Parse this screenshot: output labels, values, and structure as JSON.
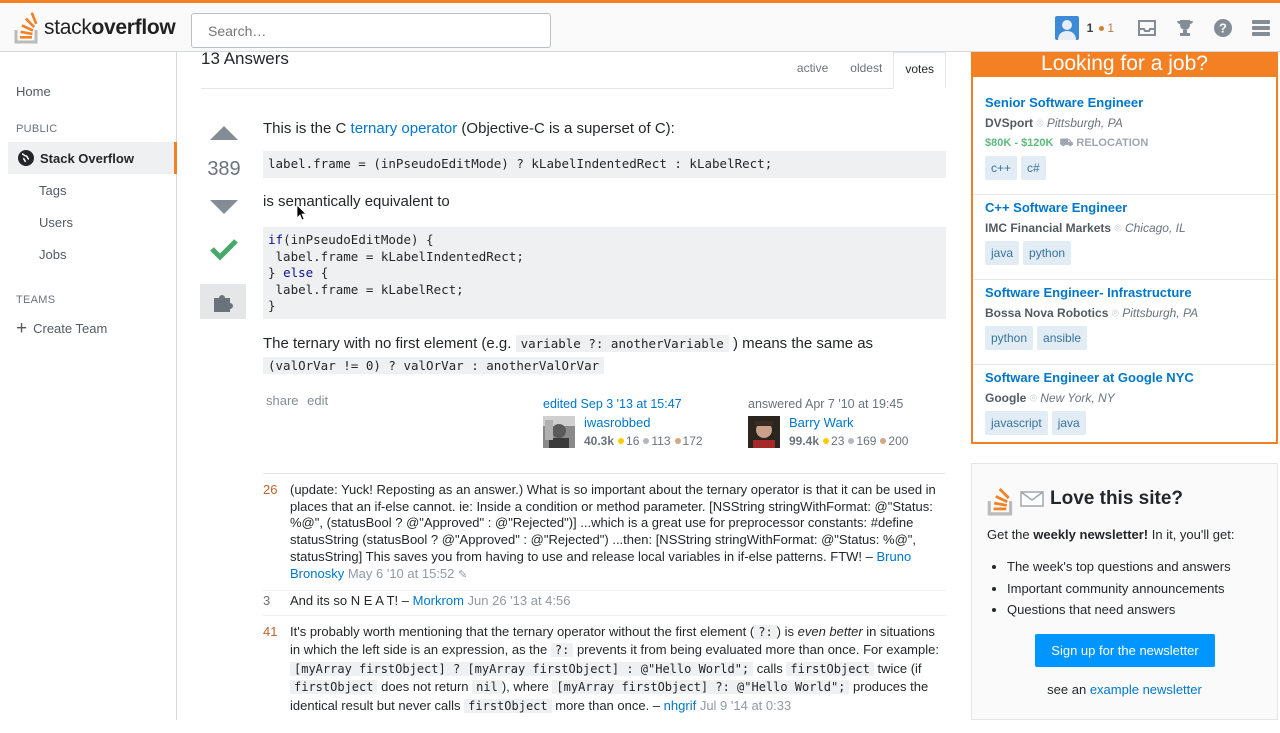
{
  "header": {
    "logo_text_light": "stack",
    "logo_text_bold": "overflow",
    "search_placeholder": "Search…",
    "reputation": "1",
    "bronze_badges": "1"
  },
  "nav": {
    "home": "Home",
    "public_label": "PUBLIC",
    "stack_overflow": "Stack Overflow",
    "tags": "Tags",
    "users": "Users",
    "jobs": "Jobs",
    "teams_label": "TEAMS",
    "create_team": "Create Team"
  },
  "answers": {
    "count_label": "13 Answers",
    "tabs": [
      "active",
      "oldest",
      "votes"
    ],
    "active_tab": "votes"
  },
  "answer": {
    "score": "389",
    "p1_pre": "This is the C ",
    "p1_link": "ternary operator",
    "p1_post": " (Objective-C is a superset of C):",
    "code1": "label.frame = (inPseudoEditMode) ? kLabelIndentedRect : kLabelRect;",
    "p2": "is semantically equivalent to",
    "code2_l1_a": "if",
    "code2_l1_b": "(inPseudoEditMode) {",
    "code2_l2": " label.frame = kLabelIndentedRect;",
    "code2_l3_a": "} ",
    "code2_l3_b": "else",
    "code2_l3_c": " {",
    "code2_l4": " label.frame = kLabelRect;",
    "code2_l5": "}",
    "p3_pre": "The ternary with no first element (e.g. ",
    "p3_code1": "variable ?: anotherVariable",
    "p3_mid": " ) means the same as",
    "p3_code2": "(valOrVar != 0) ? valOrVar : anotherValOrVar",
    "share": "share",
    "edit": "edit",
    "editor": {
      "action": "edited Sep 3 '13 at 15:47",
      "name": "iwasrobbed",
      "rep": "40.3k",
      "gold": "16",
      "silver": "113",
      "bronze": "172"
    },
    "author": {
      "action": "answered Apr 7 '10 at 19:45",
      "name": "Barry Wark",
      "rep": "99.4k",
      "gold": "23",
      "silver": "169",
      "bronze": "200"
    }
  },
  "comments": [
    {
      "score": "26",
      "text": "(update: Yuck! Reposting as an answer.) What is so important about the ternary operator is that it can be used in places that an if-else cannot. ie: Inside a condition or method parameter. [NSString stringWithFormat: @\"Status: %@\", (statusBool ? @\"Approved\" : @\"Rejected\")] ...which is a great use for preprocessor constants: #define statusString (statusBool ? @\"Approved\" : @\"Rejected\") ...then: [NSString stringWithFormat: @\"Status: %@\", statusString] This saves you from having to use and release local variables in if-else patterns. FTW!",
      "user": "Bruno Bronosky",
      "date": "May 6 '10 at 15:52"
    },
    {
      "score": "3",
      "text": "And its so N E A T!",
      "user": "Morkrom",
      "date": "Jun 26 '13 at 4:56"
    },
    {
      "score": "41",
      "t1": "It's probably worth mentioning that the ternary operator without the first element (",
      "c1": "?:",
      "t2": ") is ",
      "em": "even better",
      "t3": " in situations in which the left side is an expression, as the ",
      "c2": "?:",
      "t4": " prevents it from being evaluated more than once. For example: ",
      "c3": "[myArray firstObject] ? [myArray firstObject] : @\"Hello World\";",
      "t5": " calls ",
      "c4": "firstObject",
      "t6": " twice (if ",
      "c5": "firstObject",
      "t7": " does not return ",
      "c6": "nil",
      "t8": "), where ",
      "c7": "[myArray firstObject] ?: @\"Hello World\";",
      "t9": " produces the identical result but never calls ",
      "c8": "firstObject",
      "t10": " more than once.",
      "user": "nhgrif",
      "date": "Jul 9 '14 at 0:33"
    }
  ],
  "jobs": {
    "title": "Looking for a job?",
    "items": [
      {
        "title": "Senior Software Engineer",
        "company": "DVSport",
        "location": "Pittsburgh, PA",
        "salary": "$80K - $120K",
        "relocation": "RELOCATION",
        "tags": [
          "c++",
          "c#"
        ]
      },
      {
        "title": "C++ Software Engineer",
        "company": "IMC Financial Markets",
        "location": "Chicago, IL",
        "tags": [
          "java",
          "python"
        ]
      },
      {
        "title": "Software Engineer- Infrastructure",
        "company": "Bossa Nova Robotics",
        "location": "Pittsburgh, PA",
        "tags": [
          "python",
          "ansible"
        ]
      },
      {
        "title": "Software Engineer at Google NYC",
        "company": "Google",
        "location": "New York, NY",
        "tags": [
          "javascript",
          "java"
        ]
      }
    ]
  },
  "newsletter": {
    "title": "Love this site?",
    "sub_pre": "Get the ",
    "sub_bold": "weekly newsletter!",
    "sub_post": " In it, you'll get:",
    "items": [
      "The week's top questions and answers",
      "Important community announcements",
      "Questions that need answers"
    ],
    "button": "Sign up for the newsletter",
    "foot_pre": "see an ",
    "foot_link": "example newsletter"
  },
  "colors": {
    "brand_orange": "#f48024",
    "link_blue": "#0077cc",
    "accept_green": "#48a868",
    "button_blue": "#0095ff"
  }
}
